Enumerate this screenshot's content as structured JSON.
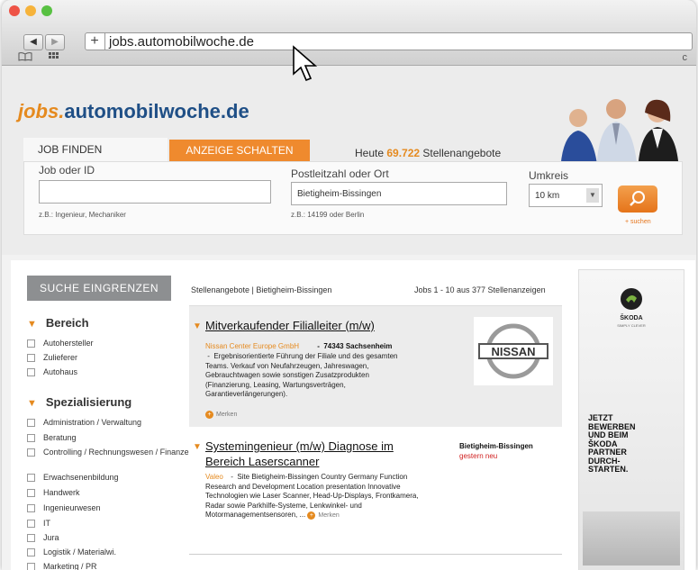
{
  "browser": {
    "url": "jobs.automobilwoche.de",
    "back_icon": "◀",
    "forward_icon": "▶",
    "add_icon": "+",
    "reload_icon": "c"
  },
  "site": {
    "logo_prefix": "jobs.",
    "logo_main": "automobilwoche.de"
  },
  "tabs": {
    "job_finden": "JOB FINDEN",
    "anzeige_schalten": "ANZEIGE SCHALTEN"
  },
  "stats": {
    "prefix": "Heute ",
    "count": "69.722",
    "suffix": " Stellenangebote"
  },
  "search": {
    "job_label": "Job oder ID",
    "job_value": "",
    "job_hint": "z.B.: Ingenieur, Mechaniker",
    "location_label": "Postleitzahl oder Ort",
    "location_value": "Bietigheim-Bissingen",
    "location_hint": "z.B.: 14199 oder Berlin",
    "radius_label": "Umkreis",
    "radius_value": "10 km",
    "submit_hint": "+ suchen"
  },
  "filters": {
    "header": "SUCHE EINGRENZEN",
    "sections": [
      {
        "title": "Bereich",
        "items": [
          "Autohersteller",
          "Zulieferer",
          "Autohaus"
        ]
      },
      {
        "title": "Spezialisierung",
        "items": [
          "Administration / Verwaltung",
          "Beratung",
          "Controlling / Rechnungswesen / Finanzen",
          "Erwachsenenbildung",
          "Handwerk",
          "Ingenieurwesen",
          "IT",
          "Jura",
          "Logistik / Materialwi.",
          "Marketing / PR"
        ]
      }
    ]
  },
  "results": {
    "breadcrumb": "Stellenangebote | Bietigheim-Bissingen",
    "range": "Jobs 1 - 10 aus 377 Stellenanzeigen",
    "jobs": [
      {
        "title": "Mitverkaufender Filialleiter (m/w)",
        "company": "Nissan Center Europe GmbH",
        "location": "74343 Sachsenheim",
        "description": "Ergebnisorientierte Führung der Filiale und des gesamten Teams. Verkauf von Neufahrzeugen, Jahreswagen, Gebrauchtwagen sowie sonstigen Zusatzprodukten (Finanzierung, Leasing, Wartungsverträgen, Garantieverlängerungen).",
        "save": "Merken",
        "logo_text": "NISSAN"
      },
      {
        "title": "Systemingenieur (m/w) Diagnose im Bereich Laserscanner",
        "company": "Valeo",
        "location": "Bietigheim-Bissingen",
        "date": "gestern neu",
        "description": "Site Bietigheim-Bissingen Country Germany Function Research and Development Location presentation Innovative Technologien wie Laser Scanner, Head-Up-Displays, Frontkamera, Radar sowie Parkhilfe-Systeme, Lenkwinkel- und Motormanagementsensoren, ...",
        "save": "Merken"
      }
    ]
  },
  "ad": {
    "brand": "ŠKODA",
    "brand_sub": "SIMPLY CLEVER",
    "lines": [
      "JETZT",
      "BEWERBEN",
      "UND BEIM",
      "ŠKODA",
      "PARTNER",
      "DURCH-",
      "STARTEN."
    ]
  },
  "colors": {
    "accent": "#e58a1f",
    "brand_blue": "#1f4f86",
    "link_red": "#d02020"
  }
}
